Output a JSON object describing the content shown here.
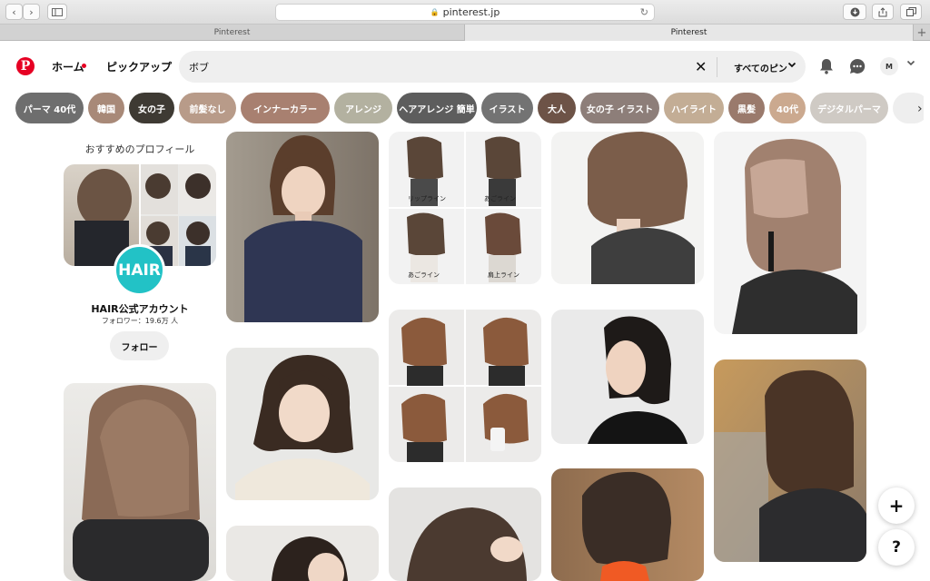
{
  "browser": {
    "url": "pinterest.jp",
    "tabs": [
      "Pinterest",
      "Pinterest"
    ]
  },
  "header": {
    "logo": "P",
    "home": "ホーム",
    "pickup": "ピックアップ",
    "search_query": "ボブ",
    "search_scope": "すべてのピン",
    "avatar_initial": "M"
  },
  "chips": [
    {
      "label": "パーマ 40代",
      "color": "#6e6e6e"
    },
    {
      "label": "韓国",
      "color": "#a88978"
    },
    {
      "label": "女の子",
      "color": "#3e3a33"
    },
    {
      "label": "前髪なし",
      "color": "#b89b89"
    },
    {
      "label": "インナーカラー",
      "color": "#a88070"
    },
    {
      "label": "アレンジ",
      "color": "#b3b1a0"
    },
    {
      "label": "ヘアアレンジ 簡単",
      "color": "#5d5d5d"
    },
    {
      "label": "イラスト",
      "color": "#737373"
    },
    {
      "label": "大人",
      "color": "#6d5347"
    },
    {
      "label": "女の子 イラスト",
      "color": "#8d7e79"
    },
    {
      "label": "ハイライト",
      "color": "#c3ad95"
    },
    {
      "label": "黒髪",
      "color": "#9a7a6c"
    },
    {
      "label": "40代",
      "color": "#cba98f"
    },
    {
      "label": "デジタルパーマ",
      "color": "#cfcac4"
    }
  ],
  "profile": {
    "section_title": "おすすめのプロフィール",
    "logo_text": "HAIR",
    "name": "HAIR公式アカウント",
    "followers": "フォロワー：19.6万 人",
    "follow_label": "フォロー"
  },
  "captions": [
    "リップライン",
    "あごライン",
    "あごライン",
    "肩上ライン"
  ],
  "fab": {
    "add": "+",
    "help": "?"
  }
}
